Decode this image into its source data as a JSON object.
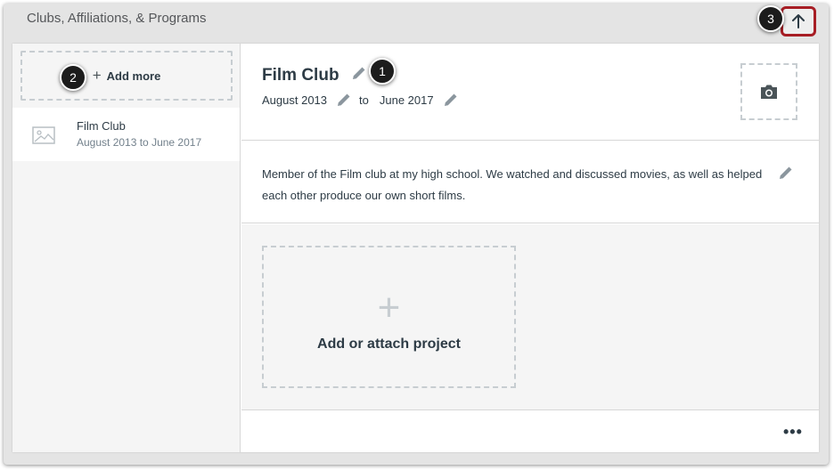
{
  "section": {
    "title": "Clubs, Affiliations, & Programs"
  },
  "callouts": {
    "one": "1",
    "two": "2",
    "three": "3"
  },
  "sidebar": {
    "add_more_label": "Add more",
    "items": [
      {
        "title": "Film Club",
        "dates": "August 2013 to June 2017",
        "icon": "image-placeholder-icon"
      }
    ]
  },
  "entry": {
    "title": "Film Club",
    "start_date": "August 2013",
    "date_separator": "to",
    "end_date": "June 2017",
    "description": "Member of the Film club at my high school. We watched and discussed movies, as well as helped each other produce our own short films.",
    "add_project_label": "Add or attach project",
    "add_project_plus": "+",
    "more_label": "•••"
  },
  "icons": {
    "collapse": "arrow-up-icon",
    "edit": "pencil-icon",
    "photo": "camera-icon"
  },
  "colors": {
    "accent_border": "#a71e25",
    "icon_gray": "#8b969e",
    "text": "#2d3b45"
  }
}
